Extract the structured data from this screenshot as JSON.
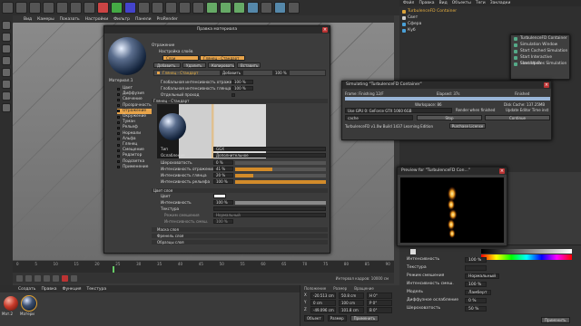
{
  "viewport_menu": [
    "Вид",
    "Камеры",
    "Показать",
    "Настройки",
    "Фильтр",
    "Панели",
    "ProRender"
  ],
  "material_editor": {
    "title": "Правка материала",
    "material_name": "Материал.1",
    "channels": [
      "Цвет",
      "Диффузия",
      "Свечение",
      "Прозрачность",
      "Отражение",
      "Окружение",
      "Туман",
      "Рельеф",
      "Нормали",
      "Альфа",
      "Глянец",
      "Смещение",
      "Редактор",
      "Подсветка",
      "Применение"
    ],
    "layer_header": "Отражение",
    "layer_settings": "Настройка слоёв",
    "tab_layers": "Слои",
    "tab_gloss": "Глянец - Стандарт",
    "layer_buttons": [
      "Добавить...",
      "Удалить",
      "Копировать",
      "Вставить"
    ],
    "layer_item": "Глянец - Стандарт",
    "layer_item_mode": "Добавить",
    "layer_item_value": "100 %",
    "global_refl_label": "Глобальная интенсивность отражения",
    "global_refl_value": "100 %",
    "global_spec_label": "Глобальная интенсивность глянца",
    "global_spec_value": "100 %",
    "separate_pass_label": "Отдельный проход",
    "gloss_section": "Глянец - Стандарт",
    "type_label": "Тип",
    "type_value": "GGX",
    "atten_label": "Ослабление",
    "atten_value": "Дополнительное",
    "rough_label": "Шероховатость",
    "rough_value": "0 %",
    "refl_strength_label": "Интенсивность отражения",
    "refl_strength_value": "41 %",
    "spec_strength_label": "Интенсивность глянца",
    "spec_strength_value": "20 %",
    "bump_label": "Интенсивность рельефа",
    "bump_value": "100 %",
    "color_section": "Цвет слоя",
    "color_label": "Цвет",
    "brightness_label": "Интенсивность",
    "brightness_value": "100 %",
    "texture_label": "Текстура",
    "blend_mode_label": "Режим смешения",
    "blend_mode_value": "Нормальный",
    "blend_strength_label": "Интенсивность смеш.",
    "blend_strength_value": "100 %",
    "collapsed_sections": [
      "Маска слоя",
      "Френель слоя",
      "Образцы слоя"
    ]
  },
  "simulation": {
    "title": "Simulating \"TurbulenceFD Container\"",
    "frame_label": "Frame: Finishing 12/F",
    "elapsed": "Elapsed: 37s",
    "finished": "Finished",
    "workspace": "Workspace: 86",
    "disk_cache": "Disk Cache: 137.25MB",
    "gpu_select": "Use GPU 0: GeForce GTX 1060 6GB",
    "render_option": "Render when finished",
    "update_option": "Update Editor Time inst",
    "cache_label": "cache",
    "stop_button": "Stop",
    "continue_button": "Continue",
    "version": "TurbulenceFD v1.0w Build 1437 Learning Edition",
    "purchase_button": "Purchase License"
  },
  "preview": {
    "title": "Preview for \"TurbulenceFD Con...\""
  },
  "objects": {
    "menu": [
      "Файл",
      "Правка",
      "Вид",
      "Объекты",
      "Теги",
      "Закладки"
    ],
    "items": [
      {
        "name": "TurbulenceFD Container",
        "color": "#d9a23a"
      },
      {
        "name": "Свет",
        "color": "#cccccc"
      },
      {
        "name": "Сфера",
        "color": "#4aa0d8"
      },
      {
        "name": "Куб",
        "color": "#4aa0d8"
      }
    ]
  },
  "context_menu": [
    "TurbulenceFD Container",
    "Simulation Window",
    "Start Cached Simulation",
    "Start Interactive Simulation",
    "Start Up-Res Simulation"
  ],
  "attributes": {
    "rows": [
      {
        "label": "Интенсивность",
        "value": "100 %"
      },
      {
        "label": "Текстура",
        "value": ""
      },
      {
        "label": "Режим смешения",
        "value": "Нормальный"
      },
      {
        "label": "Интенсивность смеш.",
        "value": "100 %"
      },
      {
        "label": "Модель",
        "value": "Ламберт"
      },
      {
        "label": "Диффузное ослабление",
        "value": "0 %"
      },
      {
        "label": "Шероховатость",
        "value": "50 %"
      }
    ],
    "apply_button": "Применить"
  },
  "materials_menu": [
    "Создать",
    "Правка",
    "Функция",
    "Текстура"
  ],
  "materials": [
    {
      "name": "Мат.2",
      "color": "#c83a2a"
    },
    {
      "name": "Матери",
      "color": "#1a2a40"
    }
  ],
  "coordinates": {
    "headers": [
      "Положение",
      "Размер",
      "Вращение"
    ],
    "rows": [
      {
        "axis": "X",
        "pos": "-20.513 cm",
        "size": "50.8 cm",
        "rot": "H 0°"
      },
      {
        "axis": "Y",
        "pos": "0 cm",
        "size": "100 cm",
        "rot": "P 0°"
      },
      {
        "axis": "Z",
        "pos": "-49.096 cm",
        "size": "101.8 cm",
        "rot": "B 0°"
      }
    ],
    "mode_select": "Объект",
    "size_select": "Размер",
    "apply_button": "Применить"
  },
  "timeline": {
    "ticks": [
      "0",
      "5",
      "10",
      "15",
      "20",
      "25",
      "30",
      "35",
      "40",
      "45",
      "50",
      "55",
      "60",
      "65",
      "70",
      "75",
      "80",
      "85",
      "90"
    ],
    "interval_label": "Интервал кадров: 10000 см"
  }
}
